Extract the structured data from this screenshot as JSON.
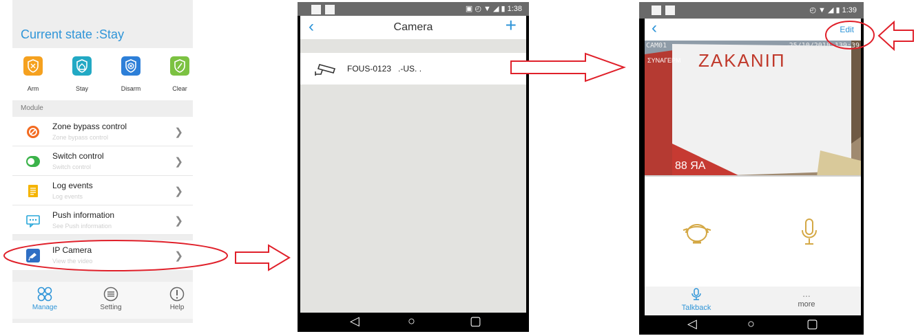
{
  "panel1": {
    "current_state": "Current state :Stay",
    "modes": [
      {
        "label": "Arm",
        "icon": "arm-icon",
        "color": "#f5a11f"
      },
      {
        "label": "Stay",
        "icon": "stay-icon",
        "color": "#22a9c4"
      },
      {
        "label": "Disarm",
        "icon": "disarm-icon",
        "color": "#2d7fd8"
      },
      {
        "label": "Clear",
        "icon": "clear-icon",
        "color": "#7cc242"
      }
    ],
    "module_header": "Module",
    "items": [
      {
        "title": "Zone bypass control",
        "subtitle": "Zone bypass control",
        "icon": "ban-icon",
        "color": "#f36b21"
      },
      {
        "title": "Switch control",
        "subtitle": "Switch control",
        "icon": "toggle-icon",
        "color": "#3bb34a"
      },
      {
        "title": "Log events",
        "subtitle": "Log events",
        "icon": "log-icon",
        "color": "#f5b400"
      },
      {
        "title": "Push information",
        "subtitle": "See Push information",
        "icon": "chat-icon",
        "color": "#27a6d9"
      }
    ],
    "ip_camera": {
      "title": "IP Camera",
      "subtitle": "View the video",
      "icon": "camera-icon",
      "color": "#2f6fc4"
    },
    "tabs": [
      {
        "label": "Manage",
        "icon": "grid-icon",
        "active": true
      },
      {
        "label": "Setting",
        "icon": "menu-icon",
        "active": false
      },
      {
        "label": "Help",
        "icon": "info-icon",
        "active": false
      }
    ],
    "accent": "#2f95d8"
  },
  "panel2": {
    "status_time": "1:38",
    "title": "Camera",
    "camera_name": "FOUS-0123",
    "camera_suffix": ".-US. .",
    "accent": "#2f95d8"
  },
  "panel3": {
    "status_time": "1:39",
    "edit_label": "Edit",
    "overlay_cam": "CAM01",
    "overlay_date": "25/10/2018 1",
    "overlay_time": "39:39",
    "box_text_1": "ZAKANIП",
    "box_text_2": "ΣΥΝΑΓΕΡΜ",
    "box_text_3": "88 ЯА",
    "talkback_label": "Talkback",
    "more_label": "more",
    "more_dots": "...",
    "accent": "#2f95d8",
    "control_color": "#d4a845"
  },
  "annotation_color": "#e0202a"
}
